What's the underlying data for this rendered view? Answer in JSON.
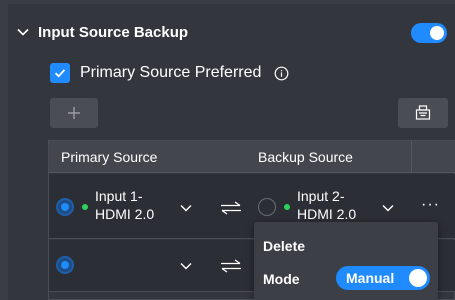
{
  "header": {
    "title": "Input Source Backup",
    "enabled": true
  },
  "options": {
    "primary_preferred_label": "Primary Source Preferred",
    "primary_preferred_checked": true
  },
  "toolbar": {
    "add_label": "+"
  },
  "table": {
    "columns": [
      "Primary Source",
      "Backup Source"
    ],
    "rows": [
      {
        "primary_selected": true,
        "primary_line1": "Input 1-",
        "primary_line2": "HDMI 2.0",
        "backup_line1": "Input 2-",
        "backup_line2": "HDMI 2.0",
        "more": "···"
      },
      {
        "primary_selected": true,
        "primary_line1": "",
        "primary_line2": "",
        "backup_line1": "",
        "backup_line2": ""
      }
    ]
  },
  "context_menu": {
    "delete_label": "Delete",
    "mode_label": "Mode",
    "mode_value": "Manual",
    "mode_on": true
  },
  "colors": {
    "accent": "#1f8bff",
    "status_online": "#2ed15a",
    "background": "#33363d"
  },
  "icons": {
    "collapse": "chevron-down-icon",
    "info": "info-circle-icon",
    "add": "plus-icon",
    "tool": "device-icon",
    "swap": "swap-arrows-icon",
    "more": "more-horizontal-icon"
  }
}
